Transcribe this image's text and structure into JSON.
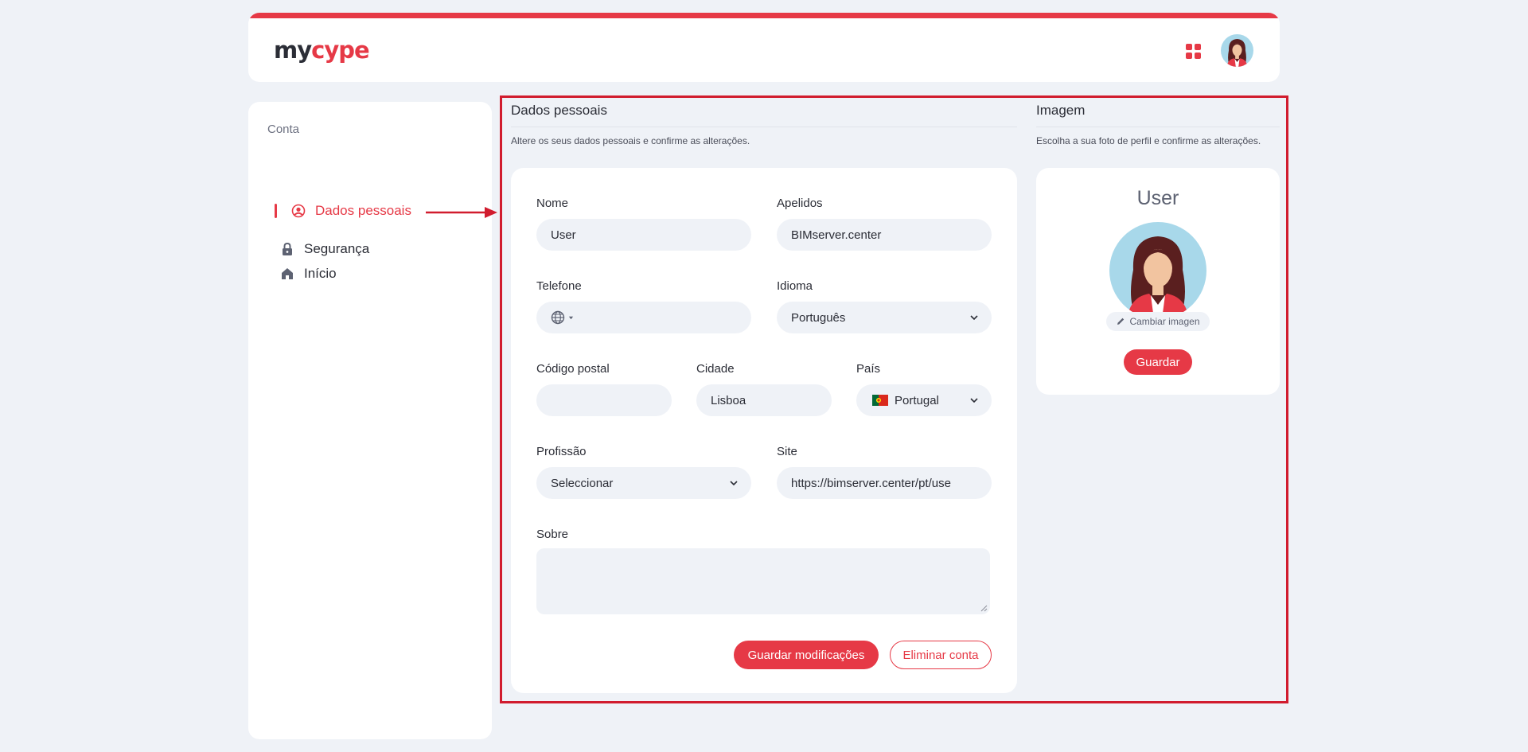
{
  "header": {
    "logo_my": "my",
    "logo_cype": "cype",
    "apps_icon": "apps-grid-icon",
    "avatar_icon": "user-avatar"
  },
  "sidebar": {
    "section_title": "Conta",
    "items": [
      {
        "label": "Início",
        "icon": "home-icon",
        "active": false
      },
      {
        "label": "Dados pessoais",
        "icon": "user-circle-icon",
        "active": true
      },
      {
        "label": "Segurança",
        "icon": "lock-icon",
        "active": false
      }
    ]
  },
  "personal": {
    "title": "Dados pessoais",
    "subtitle": "Altere os seus dados pessoais e confirme as alterações.",
    "fields": {
      "nome": {
        "label": "Nome",
        "value": "User"
      },
      "apelidos": {
        "label": "Apelidos",
        "value": "BIMserver.center"
      },
      "telefone": {
        "label": "Telefone",
        "value": ""
      },
      "idioma": {
        "label": "Idioma",
        "value": "Português"
      },
      "codigo_postal": {
        "label": "Código postal",
        "value": ""
      },
      "cidade": {
        "label": "Cidade",
        "value": "Lisboa"
      },
      "pais": {
        "label": "País",
        "value": "Portugal"
      },
      "profissao": {
        "label": "Profissão",
        "value": "Seleccionar"
      },
      "site": {
        "label": "Site",
        "value": "https://bimserver.center/pt/use"
      },
      "sobre": {
        "label": "Sobre",
        "value": ""
      }
    },
    "save_button": "Guardar modificações",
    "delete_button": "Eliminar conta"
  },
  "image": {
    "title": "Imagem",
    "subtitle": "Escolha a sua foto de perfil e confirme as alterações.",
    "user_name": "User",
    "change_label": "Cambiar imagen",
    "save_button": "Guardar"
  },
  "colors": {
    "accent": "#e63946",
    "annotation": "#d11c2e",
    "background": "#eff2f7"
  }
}
